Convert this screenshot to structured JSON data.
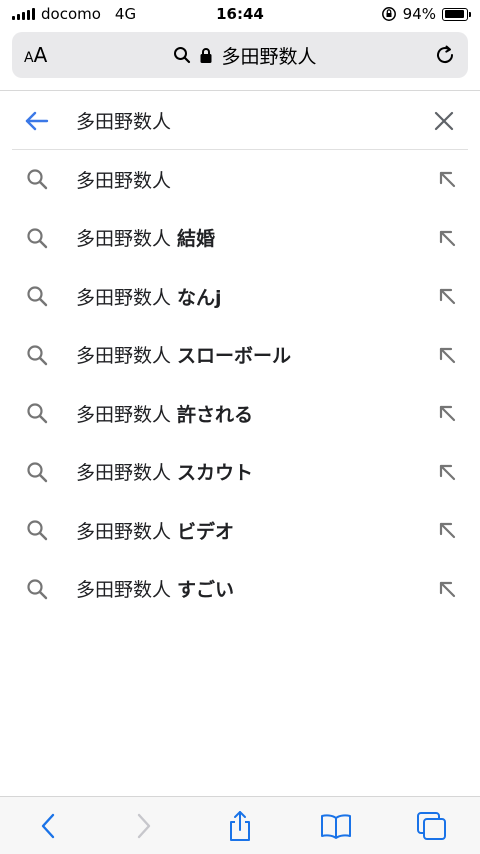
{
  "status": {
    "carrier": "docomo",
    "network": "4G",
    "time": "16:44",
    "battery_text": "94%",
    "battery_level": 0.94
  },
  "address_bar": {
    "text_size_label": "AA",
    "url_text": "多田野数人"
  },
  "search": {
    "query": "多田野数人"
  },
  "suggestions": [
    {
      "base": "多田野数人",
      "rest": ""
    },
    {
      "base": "多田野数人",
      "rest": "結婚"
    },
    {
      "base": "多田野数人",
      "rest": "なんj"
    },
    {
      "base": "多田野数人",
      "rest": "スローボール"
    },
    {
      "base": "多田野数人",
      "rest": "許される"
    },
    {
      "base": "多田野数人",
      "rest": "スカウト"
    },
    {
      "base": "多田野数人",
      "rest": "ビデオ"
    },
    {
      "base": "多田野数人",
      "rest": "すごい"
    }
  ],
  "colors": {
    "accent": "#3b78e7",
    "icon_gray": "#757575",
    "toolbar_blue": "#1a73e8"
  }
}
